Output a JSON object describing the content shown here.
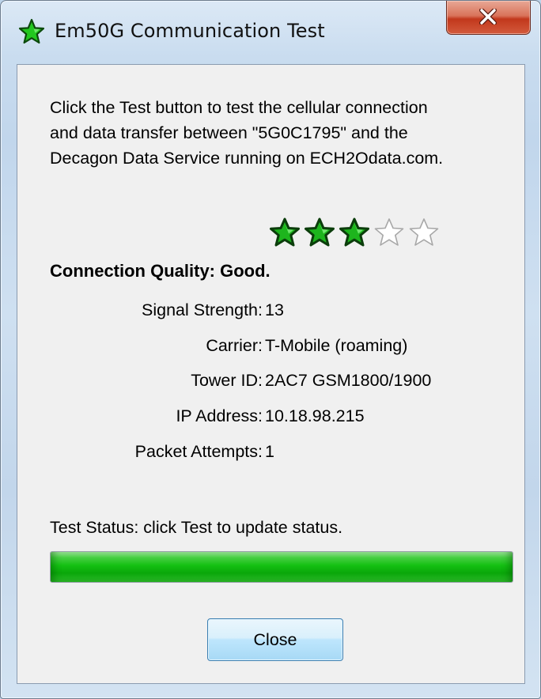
{
  "window": {
    "title": "Em50G Communication Test",
    "icon": "green-star-icon",
    "close_icon": "close-x-icon"
  },
  "intro": {
    "line1": "Click the Test button to test the cellular connection",
    "line2": "and data transfer between \"5G0C1795\" and the",
    "line3": "Decagon Data Service running on ECH2Odata.com."
  },
  "rating": {
    "filled": 3,
    "total": 5,
    "filled_color": "#1db51d",
    "empty_color": "#ffffff"
  },
  "quality": {
    "text": "Connection Quality: Good."
  },
  "details": [
    {
      "label": "Signal Strength:",
      "value": "13"
    },
    {
      "label": "Carrier:",
      "value": "T-Mobile (roaming)"
    },
    {
      "label": "Tower ID:",
      "value": "2AC7 GSM1800/1900"
    },
    {
      "label": "IP Address:",
      "value": "10.18.98.215"
    },
    {
      "label": "Packet Attempts:",
      "value": "1"
    }
  ],
  "status": {
    "text": "Test Status: click Test to update status."
  },
  "progress": {
    "fraction": 1.0,
    "color": "#14c012"
  },
  "buttons": {
    "close_label": "Close"
  }
}
